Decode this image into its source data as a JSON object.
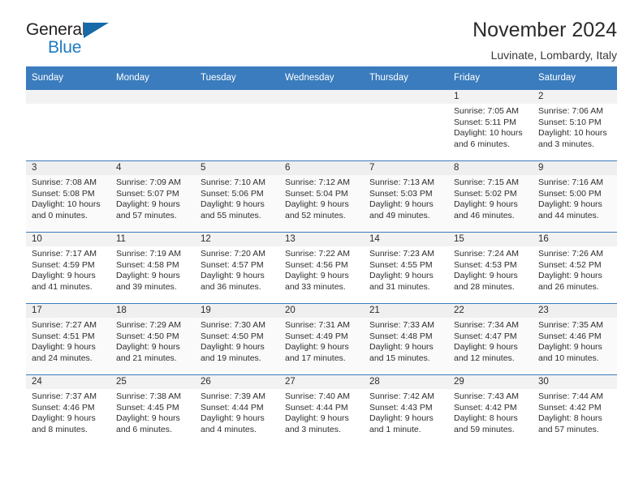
{
  "brand": {
    "name_top": "General",
    "name_bottom": "Blue",
    "triangle_icon": "brand-triangle-icon",
    "color_black": "#231f20",
    "color_blue": "#1f7bc1"
  },
  "header": {
    "title": "November 2024",
    "subtitle": "Luvinate, Lombardy, Italy",
    "accent_color": "#3a7cbd"
  },
  "calendar": {
    "weekday_headers": [
      "Sunday",
      "Monday",
      "Tuesday",
      "Wednesday",
      "Thursday",
      "Friday",
      "Saturday"
    ],
    "labels": {
      "sunrise": "Sunrise:",
      "sunset": "Sunset:",
      "daylight": "Daylight:"
    },
    "weeks": [
      [
        {
          "day": "",
          "lines": []
        },
        {
          "day": "",
          "lines": []
        },
        {
          "day": "",
          "lines": []
        },
        {
          "day": "",
          "lines": []
        },
        {
          "day": "",
          "lines": []
        },
        {
          "day": "1",
          "lines": [
            "Sunrise: 7:05 AM",
            "Sunset: 5:11 PM",
            "Daylight: 10 hours",
            "and 6 minutes."
          ]
        },
        {
          "day": "2",
          "lines": [
            "Sunrise: 7:06 AM",
            "Sunset: 5:10 PM",
            "Daylight: 10 hours",
            "and 3 minutes."
          ]
        }
      ],
      [
        {
          "day": "3",
          "lines": [
            "Sunrise: 7:08 AM",
            "Sunset: 5:08 PM",
            "Daylight: 10 hours",
            "and 0 minutes."
          ]
        },
        {
          "day": "4",
          "lines": [
            "Sunrise: 7:09 AM",
            "Sunset: 5:07 PM",
            "Daylight: 9 hours",
            "and 57 minutes."
          ]
        },
        {
          "day": "5",
          "lines": [
            "Sunrise: 7:10 AM",
            "Sunset: 5:06 PM",
            "Daylight: 9 hours",
            "and 55 minutes."
          ]
        },
        {
          "day": "6",
          "lines": [
            "Sunrise: 7:12 AM",
            "Sunset: 5:04 PM",
            "Daylight: 9 hours",
            "and 52 minutes."
          ]
        },
        {
          "day": "7",
          "lines": [
            "Sunrise: 7:13 AM",
            "Sunset: 5:03 PM",
            "Daylight: 9 hours",
            "and 49 minutes."
          ]
        },
        {
          "day": "8",
          "lines": [
            "Sunrise: 7:15 AM",
            "Sunset: 5:02 PM",
            "Daylight: 9 hours",
            "and 46 minutes."
          ]
        },
        {
          "day": "9",
          "lines": [
            "Sunrise: 7:16 AM",
            "Sunset: 5:00 PM",
            "Daylight: 9 hours",
            "and 44 minutes."
          ]
        }
      ],
      [
        {
          "day": "10",
          "lines": [
            "Sunrise: 7:17 AM",
            "Sunset: 4:59 PM",
            "Daylight: 9 hours",
            "and 41 minutes."
          ]
        },
        {
          "day": "11",
          "lines": [
            "Sunrise: 7:19 AM",
            "Sunset: 4:58 PM",
            "Daylight: 9 hours",
            "and 39 minutes."
          ]
        },
        {
          "day": "12",
          "lines": [
            "Sunrise: 7:20 AM",
            "Sunset: 4:57 PM",
            "Daylight: 9 hours",
            "and 36 minutes."
          ]
        },
        {
          "day": "13",
          "lines": [
            "Sunrise: 7:22 AM",
            "Sunset: 4:56 PM",
            "Daylight: 9 hours",
            "and 33 minutes."
          ]
        },
        {
          "day": "14",
          "lines": [
            "Sunrise: 7:23 AM",
            "Sunset: 4:55 PM",
            "Daylight: 9 hours",
            "and 31 minutes."
          ]
        },
        {
          "day": "15",
          "lines": [
            "Sunrise: 7:24 AM",
            "Sunset: 4:53 PM",
            "Daylight: 9 hours",
            "and 28 minutes."
          ]
        },
        {
          "day": "16",
          "lines": [
            "Sunrise: 7:26 AM",
            "Sunset: 4:52 PM",
            "Daylight: 9 hours",
            "and 26 minutes."
          ]
        }
      ],
      [
        {
          "day": "17",
          "lines": [
            "Sunrise: 7:27 AM",
            "Sunset: 4:51 PM",
            "Daylight: 9 hours",
            "and 24 minutes."
          ]
        },
        {
          "day": "18",
          "lines": [
            "Sunrise: 7:29 AM",
            "Sunset: 4:50 PM",
            "Daylight: 9 hours",
            "and 21 minutes."
          ]
        },
        {
          "day": "19",
          "lines": [
            "Sunrise: 7:30 AM",
            "Sunset: 4:50 PM",
            "Daylight: 9 hours",
            "and 19 minutes."
          ]
        },
        {
          "day": "20",
          "lines": [
            "Sunrise: 7:31 AM",
            "Sunset: 4:49 PM",
            "Daylight: 9 hours",
            "and 17 minutes."
          ]
        },
        {
          "day": "21",
          "lines": [
            "Sunrise: 7:33 AM",
            "Sunset: 4:48 PM",
            "Daylight: 9 hours",
            "and 15 minutes."
          ]
        },
        {
          "day": "22",
          "lines": [
            "Sunrise: 7:34 AM",
            "Sunset: 4:47 PM",
            "Daylight: 9 hours",
            "and 12 minutes."
          ]
        },
        {
          "day": "23",
          "lines": [
            "Sunrise: 7:35 AM",
            "Sunset: 4:46 PM",
            "Daylight: 9 hours",
            "and 10 minutes."
          ]
        }
      ],
      [
        {
          "day": "24",
          "lines": [
            "Sunrise: 7:37 AM",
            "Sunset: 4:46 PM",
            "Daylight: 9 hours",
            "and 8 minutes."
          ]
        },
        {
          "day": "25",
          "lines": [
            "Sunrise: 7:38 AM",
            "Sunset: 4:45 PM",
            "Daylight: 9 hours",
            "and 6 minutes."
          ]
        },
        {
          "day": "26",
          "lines": [
            "Sunrise: 7:39 AM",
            "Sunset: 4:44 PM",
            "Daylight: 9 hours",
            "and 4 minutes."
          ]
        },
        {
          "day": "27",
          "lines": [
            "Sunrise: 7:40 AM",
            "Sunset: 4:44 PM",
            "Daylight: 9 hours",
            "and 3 minutes."
          ]
        },
        {
          "day": "28",
          "lines": [
            "Sunrise: 7:42 AM",
            "Sunset: 4:43 PM",
            "Daylight: 9 hours",
            "and 1 minute."
          ]
        },
        {
          "day": "29",
          "lines": [
            "Sunrise: 7:43 AM",
            "Sunset: 4:42 PM",
            "Daylight: 8 hours",
            "and 59 minutes."
          ]
        },
        {
          "day": "30",
          "lines": [
            "Sunrise: 7:44 AM",
            "Sunset: 4:42 PM",
            "Daylight: 8 hours",
            "and 57 minutes."
          ]
        }
      ]
    ]
  }
}
